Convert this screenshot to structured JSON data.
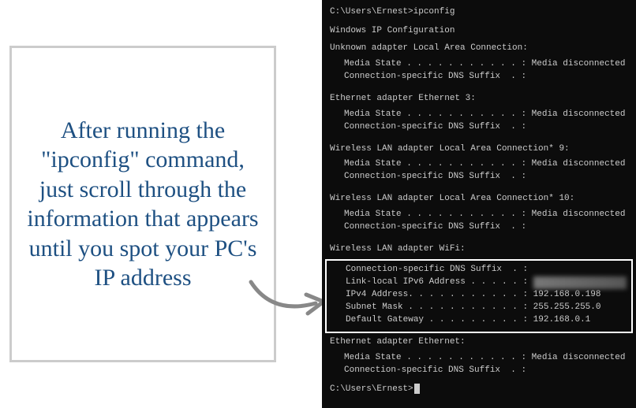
{
  "callout": {
    "text": "After running the \"ipconfig\" command, just scroll through the information that appears until you spot your PC's IP address"
  },
  "terminal": {
    "prompt1_path": "C:\\Users\\Ernest>",
    "prompt1_cmd": "ipconfig",
    "header": "Windows IP Configuration",
    "adapters": [
      {
        "title": "Unknown adapter Local Area Connection:",
        "rows": [
          {
            "label": "Media State . . . . . . . . . . .",
            "sep": " : ",
            "value": "Media disconnected"
          },
          {
            "label": "Connection-specific DNS Suffix  .",
            "sep": " :",
            "value": ""
          }
        ]
      },
      {
        "title": "Ethernet adapter Ethernet 3:",
        "rows": [
          {
            "label": "Media State . . . . . . . . . . .",
            "sep": " : ",
            "value": "Media disconnected"
          },
          {
            "label": "Connection-specific DNS Suffix  .",
            "sep": " :",
            "value": ""
          }
        ]
      },
      {
        "title": "Wireless LAN adapter Local Area Connection* 9:",
        "rows": [
          {
            "label": "Media State . . . . . . . . . . .",
            "sep": " : ",
            "value": "Media disconnected"
          },
          {
            "label": "Connection-specific DNS Suffix  .",
            "sep": " :",
            "value": ""
          }
        ]
      },
      {
        "title": "Wireless LAN adapter Local Area Connection* 10:",
        "rows": [
          {
            "label": "Media State . . . . . . . . . . .",
            "sep": " : ",
            "value": "Media disconnected"
          },
          {
            "label": "Connection-specific DNS Suffix  .",
            "sep": " :",
            "value": ""
          }
        ]
      }
    ],
    "wifi": {
      "title": "Wireless LAN adapter WiFi:",
      "rows": [
        {
          "label": "Connection-specific DNS Suffix  .",
          "sep": " :",
          "value": ""
        },
        {
          "label": "Link-local IPv6 Address . . . . .",
          "sep": " : ",
          "value": "[redacted]"
        },
        {
          "label": "IPv4 Address. . . . . . . . . . .",
          "sep": " : ",
          "value": "192.168.0.198"
        },
        {
          "label": "Subnet Mask . . . . . . . . . . .",
          "sep": " : ",
          "value": "255.255.255.0"
        },
        {
          "label": "Default Gateway . . . . . . . . .",
          "sep": " : ",
          "value": "192.168.0.1"
        }
      ]
    },
    "ethernet": {
      "title": "Ethernet adapter Ethernet:",
      "rows": [
        {
          "label": "Media State . . . . . . . . . . .",
          "sep": " : ",
          "value": "Media disconnected"
        },
        {
          "label": "Connection-specific DNS Suffix  .",
          "sep": " :",
          "value": ""
        }
      ]
    },
    "prompt2_path": "C:\\Users\\Ernest>"
  }
}
